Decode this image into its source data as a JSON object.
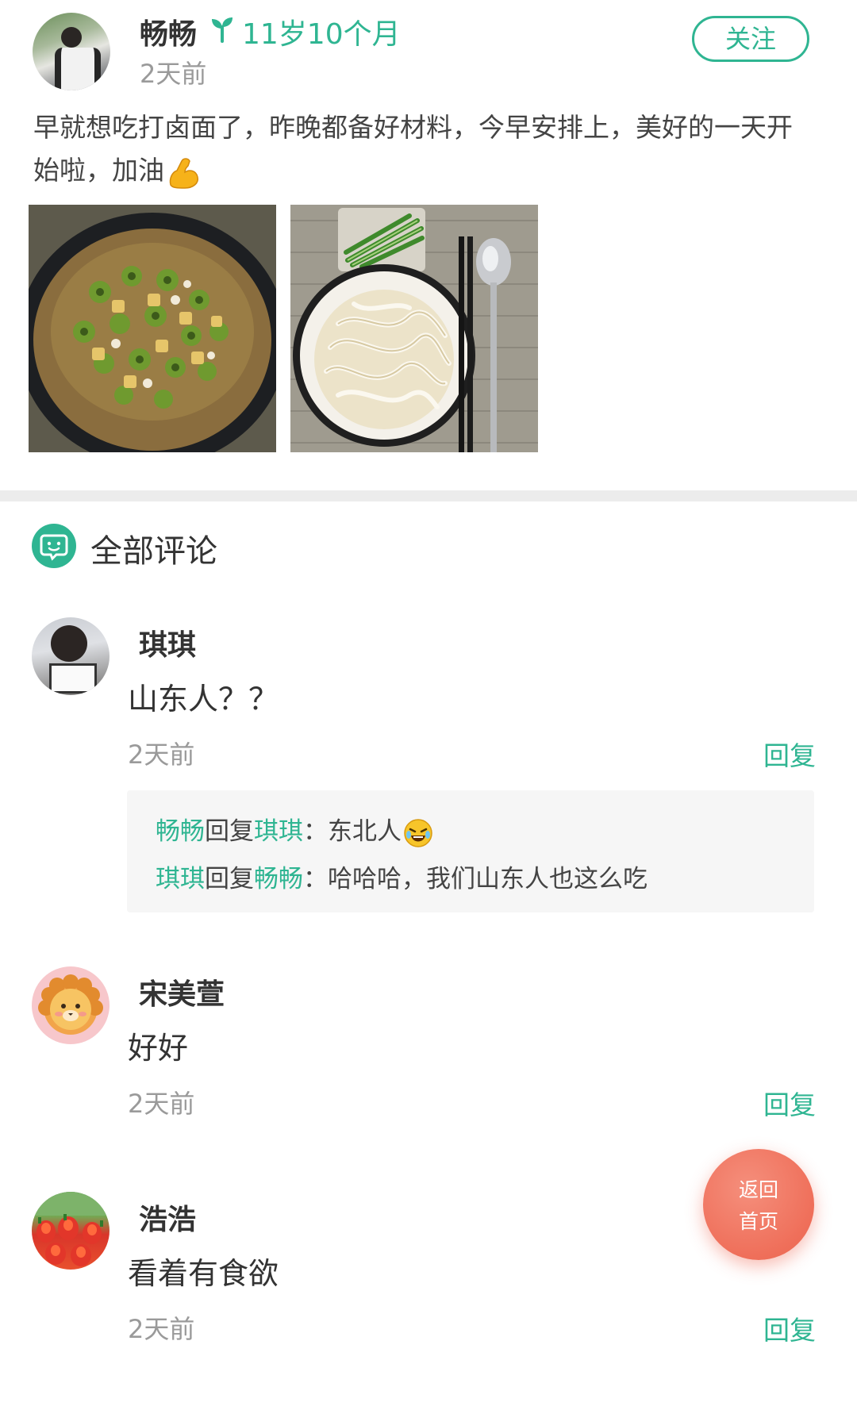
{
  "post": {
    "author": "畅畅",
    "age": "11岁10个月",
    "time": "2天前",
    "follow_label": "关注",
    "text": "早就想吃打卤面了，昨晚都备好材料，今早安排上，美好的一天开始啦，加油"
  },
  "comments_section": {
    "title": "全部评论"
  },
  "comments": [
    {
      "name": "琪琪",
      "text": "山东人？？",
      "time": "2天前",
      "reply_label": "回复",
      "replies": [
        {
          "from": "畅畅",
          "verb": "回复",
          "to": "琪琪",
          "text": "：东北人"
        },
        {
          "from": "琪琪",
          "verb": "回复",
          "to": "畅畅",
          "text": "：哈哈哈，我们山东人也这么吃"
        }
      ]
    },
    {
      "name": "宋美萱",
      "text": "好好",
      "time": "2天前",
      "reply_label": "回复"
    },
    {
      "name": "浩浩",
      "text": "看着有食欲",
      "time": "2天前",
      "reply_label": "回复"
    }
  ],
  "fab": {
    "line1": "返回",
    "line2": "首页"
  },
  "colors": {
    "accent": "#2fb592",
    "fab": "#ef6f5a",
    "muted": "#9a9a9a"
  }
}
